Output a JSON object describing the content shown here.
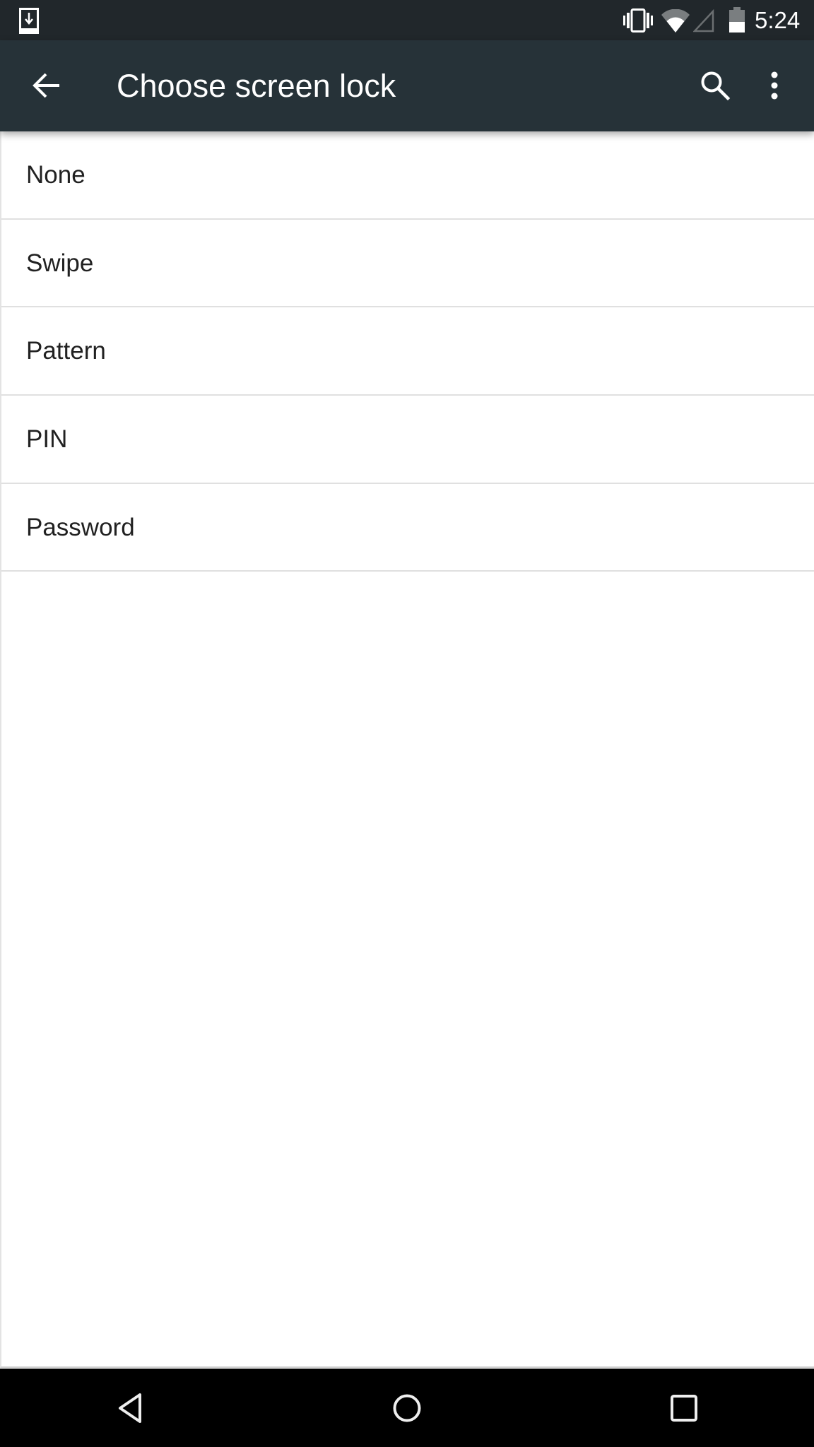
{
  "status_bar": {
    "time": "5:24",
    "left_icons": [
      {
        "name": "download-notification-icon"
      }
    ],
    "right_icons": [
      {
        "name": "vibrate-icon"
      },
      {
        "name": "wifi-icon",
        "signal_level": "partial"
      },
      {
        "name": "cell-signal-icon",
        "signal_level": "none"
      },
      {
        "name": "battery-icon",
        "charge_fraction": 0.45
      }
    ]
  },
  "app_bar": {
    "title": "Choose screen lock",
    "back_icon": "arrow-back-icon",
    "actions": [
      {
        "name": "search",
        "icon": "search-icon"
      },
      {
        "name": "more-options",
        "icon": "more-vert-icon"
      }
    ],
    "background_color": "#263238"
  },
  "screen_lock_options": [
    {
      "label": "None"
    },
    {
      "label": "Swipe"
    },
    {
      "label": "Pattern"
    },
    {
      "label": "PIN"
    },
    {
      "label": "Password"
    }
  ],
  "nav_bar": {
    "buttons": [
      {
        "name": "back",
        "icon": "nav-back-icon"
      },
      {
        "name": "home",
        "icon": "nav-home-icon"
      },
      {
        "name": "recents",
        "icon": "nav-recents-icon"
      }
    ]
  },
  "colors": {
    "status_bar": "#21272b",
    "app_bar": "#263238",
    "list_text": "#212121",
    "divider": "#e0e0e0",
    "nav_bar": "#000000"
  }
}
